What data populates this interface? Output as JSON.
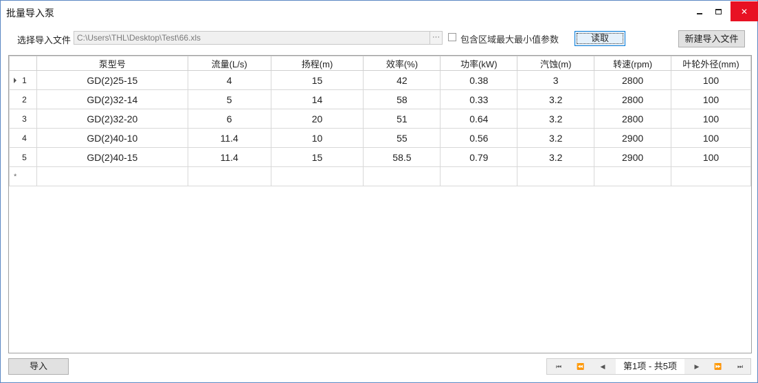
{
  "window": {
    "title": "批量导入泵",
    "minimize_glyph": "",
    "maximize_glyph": "",
    "close_glyph": "✕"
  },
  "toolbar": {
    "file_label": "选择导入文件",
    "file_path": "C:\\Users\\THL\\Desktop\\Test\\66.xls",
    "browse_glyph": "···",
    "include_minmax_label": "包含区域最大最小值参数",
    "include_minmax_checked": false,
    "read_button": "读取",
    "new_import_button": "新建导入文件"
  },
  "grid": {
    "columns": [
      "泵型号",
      "流量(L/s)",
      "扬程(m)",
      "效率(%)",
      "功率(kW)",
      "汽蚀(m)",
      "转速(rpm)",
      "叶轮外径(mm)"
    ],
    "rows": [
      {
        "num": "1",
        "current": true,
        "cells": [
          "GD(2)25-15",
          "4",
          "15",
          "42",
          "0.38",
          "3",
          "2800",
          "100"
        ]
      },
      {
        "num": "2",
        "current": false,
        "cells": [
          "GD(2)32-14",
          "5",
          "14",
          "58",
          "0.33",
          "3.2",
          "2800",
          "100"
        ]
      },
      {
        "num": "3",
        "current": false,
        "cells": [
          "GD(2)32-20",
          "6",
          "20",
          "51",
          "0.64",
          "3.2",
          "2800",
          "100"
        ]
      },
      {
        "num": "4",
        "current": false,
        "cells": [
          "GD(2)40-10",
          "11.4",
          "10",
          "55",
          "0.56",
          "3.2",
          "2900",
          "100"
        ]
      },
      {
        "num": "5",
        "current": false,
        "cells": [
          "GD(2)40-15",
          "11.4",
          "15",
          "58.5",
          "0.79",
          "3.2",
          "2900",
          "100"
        ]
      }
    ],
    "new_row_marker": "*"
  },
  "footer": {
    "import_button": "导入",
    "pager": {
      "first_glyph": "⏮",
      "prev_page_glyph": "⏪",
      "prev_glyph": "◀",
      "info": "第1项 - 共5项",
      "next_glyph": "▶",
      "next_page_glyph": "⏩",
      "last_glyph": "⏭"
    }
  }
}
